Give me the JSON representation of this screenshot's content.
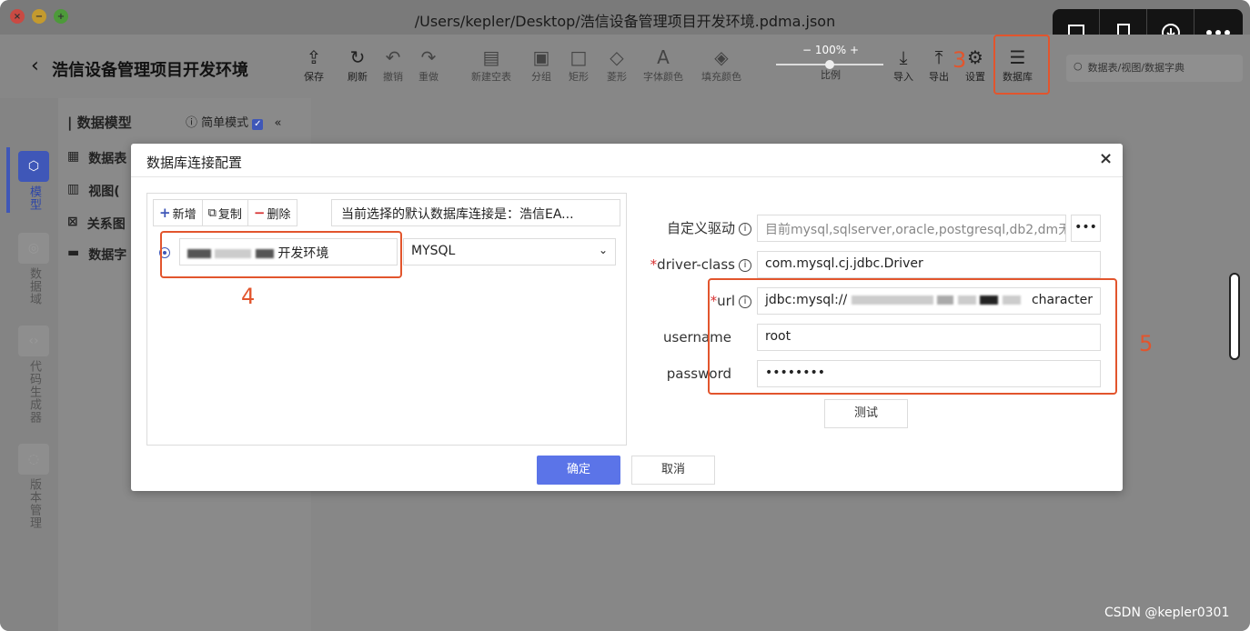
{
  "window": {
    "title": "/Users/kepler/Desktop/浩信设备管理项目开发环境.pdma.json"
  },
  "overlay": {
    "icons": [
      "chat-bubble-icon",
      "screen-icon",
      "download-icon",
      "more-icon"
    ]
  },
  "toolbar": {
    "project_title": "浩信设备管理项目开发环境",
    "tools": [
      {
        "label": "保存",
        "glyph": "⇪"
      },
      {
        "label": "刷新",
        "glyph": "↻"
      },
      {
        "label": "撤销",
        "glyph": "↶"
      },
      {
        "label": "重做",
        "glyph": "↷"
      },
      {
        "label": "新建空表",
        "glyph": "▤"
      },
      {
        "label": "分组",
        "glyph": "▣"
      },
      {
        "label": "矩形",
        "glyph": "□"
      },
      {
        "label": "菱形",
        "glyph": "◇"
      },
      {
        "label": "字体颜色",
        "glyph": "A"
      },
      {
        "label": "填充颜色",
        "glyph": "◈"
      },
      {
        "label": "导入",
        "glyph": "⤓"
      },
      {
        "label": "导出",
        "glyph": "⤒"
      },
      {
        "label": "设置",
        "glyph": "⚙"
      },
      {
        "label": "数据库",
        "glyph": "☰"
      }
    ],
    "zoom": {
      "value": "100%",
      "minus": "−",
      "plus": "+",
      "label": "比例"
    },
    "search_placeholder": "数据表/视图/数据字典",
    "annotation_3": "3"
  },
  "sidebar": {
    "items": [
      {
        "label": "模型"
      },
      {
        "label": "数据域"
      },
      {
        "label": "代码生成器"
      },
      {
        "label": "版本管理"
      }
    ]
  },
  "panel": {
    "heading": "数据模型",
    "simple_mode": "简单模式",
    "collapse": "«",
    "tree": [
      {
        "label": "数据表",
        "glyph": "▦"
      },
      {
        "label": "视图(",
        "glyph": "▥"
      },
      {
        "label": "关系图",
        "glyph": "⊠"
      },
      {
        "label": "数据字",
        "glyph": "▬"
      }
    ]
  },
  "modal": {
    "title": "数据库连接配置",
    "close": "×",
    "add": "新增",
    "copy": "复制",
    "delete": "删除",
    "default_conn": "当前选择的默认数据库连接是：浩信EA...",
    "conn_name": "开发环境",
    "db_type": "MYSQL",
    "annotation_4": "4",
    "annotation_5": "5",
    "fields": {
      "custom_driver_label": "自定义驱动",
      "custom_driver_placeholder": "目前mysql,sqlserver,oracle,postgresql,db2,dm无",
      "driver_class_label": "driver-class",
      "driver_class_value": "com.mysql.cj.jdbc.Driver",
      "url_label": "url",
      "url_value_prefix": "jdbc:mysql://",
      "url_value_suffix": "character",
      "username_label": "username",
      "username_value": "root",
      "password_label": "password",
      "password_value": "••••••••"
    },
    "more_btn": "•••",
    "test_btn": "测试",
    "ok_btn": "确定",
    "cancel_btn": "取消"
  },
  "watermark": "CSDN @kepler0301"
}
